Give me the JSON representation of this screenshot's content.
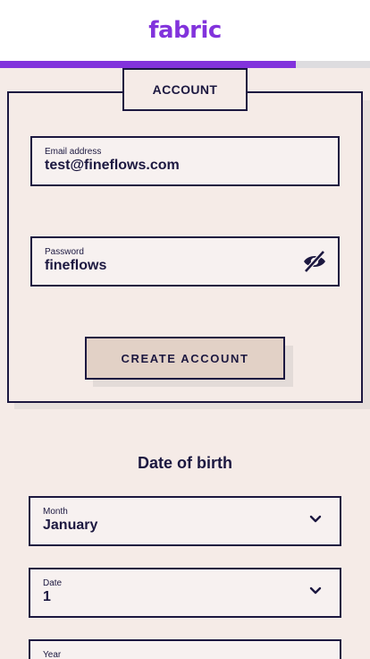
{
  "header": {
    "logo": "fabric"
  },
  "progress": {
    "fraction": 0.8
  },
  "account": {
    "tab_label": "ACCOUNT",
    "email": {
      "label": "Email address",
      "value": "test@fineflows.com"
    },
    "password": {
      "label": "Password",
      "value": "fineflows",
      "icon": "eye-off-icon"
    },
    "create_button": "CREATE ACCOUNT"
  },
  "dob": {
    "title": "Date of birth",
    "month": {
      "label": "Month",
      "value": "January"
    },
    "date": {
      "label": "Date",
      "value": "1"
    },
    "year": {
      "label": "Year",
      "value": ""
    }
  },
  "colors": {
    "brand": "#8233dc",
    "ink": "#1c1840",
    "background": "#f5ebe7",
    "button": "#e2d1c6"
  }
}
